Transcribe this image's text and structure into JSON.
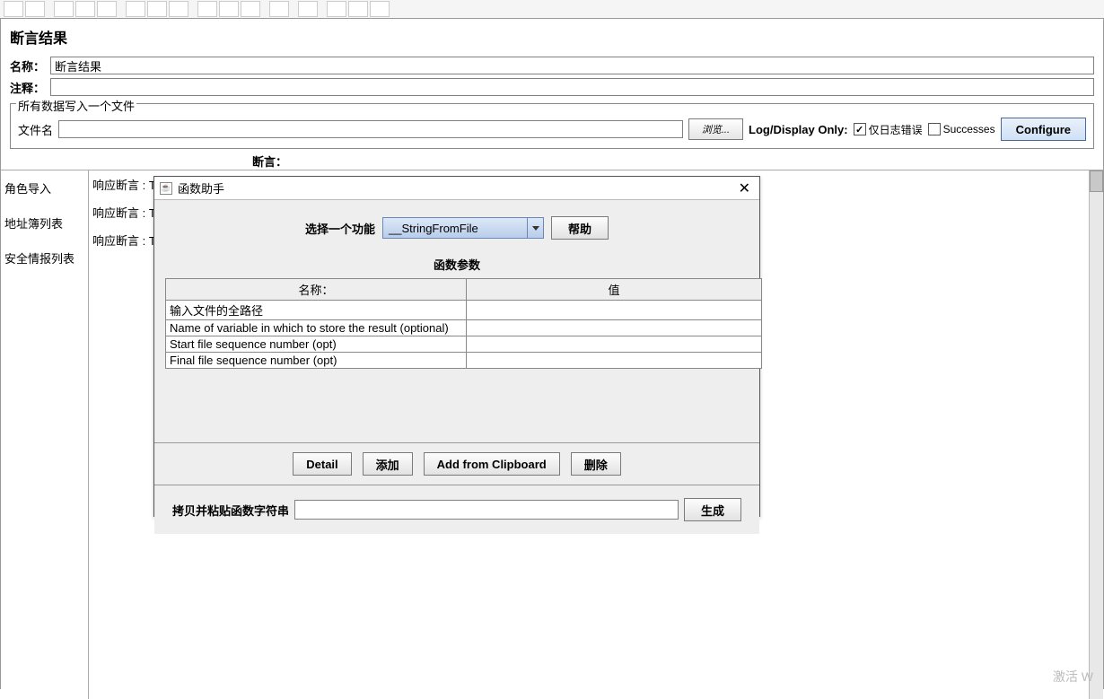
{
  "panel": {
    "title": "断言结果",
    "name_label": "名称：",
    "name_value": "断言结果",
    "comment_label": "注释：",
    "comment_value": ""
  },
  "fieldset": {
    "title": "所有数据写入一个文件",
    "filename_label": "文件名",
    "browse_label": "浏览...",
    "logdisplay_label": "Log/Display Only:",
    "errors_only_label": "仅日志错误",
    "errors_only_checked": "✓",
    "successes_label": "Successes",
    "successes_checked": "",
    "configure_label": "Configure"
  },
  "asserts": {
    "label": "断言：",
    "side_items": [
      "角色导入",
      "地址簿列表",
      "安全情报列表"
    ],
    "lines": [
      "响应断言 : Test failed: text expected not to contain /不正确/",
      "响应断言 : Tes",
      "响应断言 : Tes"
    ]
  },
  "dialog": {
    "title": "函数助手",
    "select_label": "选择一个功能",
    "select_value": "__StringFromFile",
    "help_label": "帮助",
    "param_title": "函数参数",
    "col_name": "名称：",
    "col_value": "值",
    "rows": [
      {
        "name": "输入文件的全路径",
        "value": ""
      },
      {
        "name": "Name of variable in which to store the result (optional)",
        "value": ""
      },
      {
        "name": "Start file sequence number (opt)",
        "value": ""
      },
      {
        "name": "Final file sequence number (opt)",
        "value": ""
      }
    ],
    "btn_detail": "Detail",
    "btn_add": "添加",
    "btn_clip": "Add from Clipboard",
    "btn_delete": "删除",
    "copy_label": "拷贝并粘贴函数字符串",
    "gen_label": "生成"
  },
  "watermark": "激活 W"
}
